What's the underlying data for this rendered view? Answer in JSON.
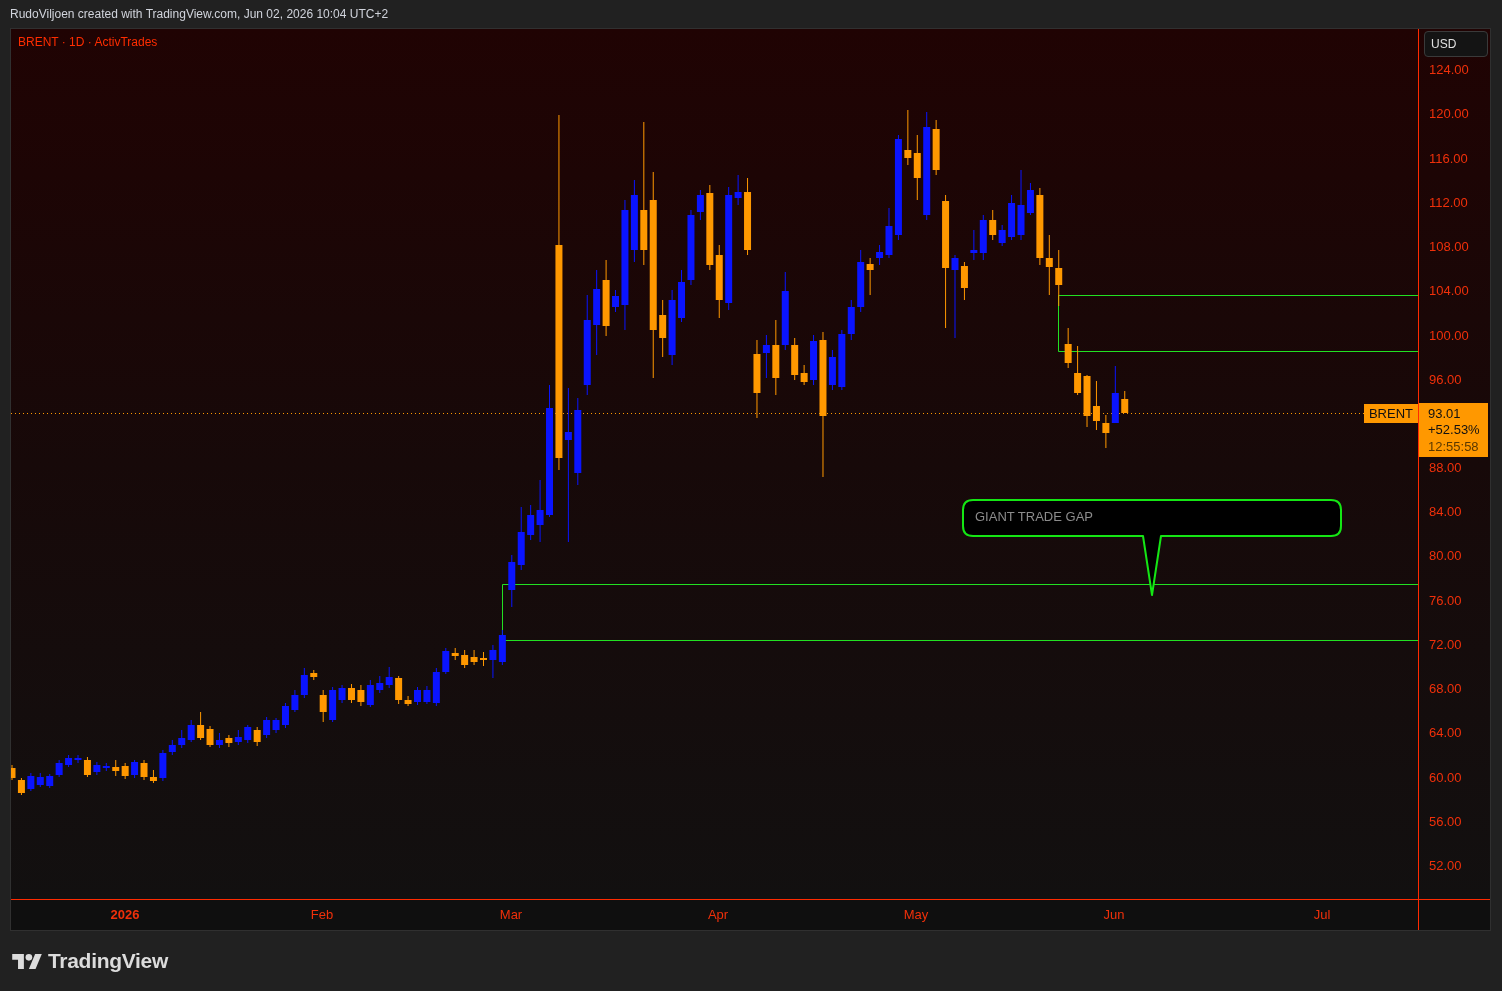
{
  "header": {
    "text": "RudoViljoen created with TradingView.com, Jun 02, 2026 10:04 UTC+2"
  },
  "chart": {
    "legend": "BRENT · 1D · ActivTrades",
    "symbol_tag": "BRENT",
    "annotation": "GIANT TRADE GAP",
    "currency_button": "USD",
    "price_axis": {
      "upper_ticks": [
        "124.00",
        "120.00",
        "116.00",
        "112.00",
        "108.00",
        "104.00",
        "100.00",
        "96.00"
      ],
      "lower_ticks": [
        "88.00",
        "84.00",
        "80.00",
        "76.00",
        "72.00",
        "68.00",
        "64.00",
        "60.00",
        "56.00",
        "52.00"
      ]
    },
    "last_price": {
      "price": "93.01",
      "change": "+52.53%",
      "countdown": "12:55:58"
    },
    "time_axis": [
      {
        "label": "2026",
        "kind": "year"
      },
      {
        "label": "Feb",
        "kind": "month"
      },
      {
        "label": "Mar",
        "kind": "month"
      },
      {
        "label": "Apr",
        "kind": "month"
      },
      {
        "label": "May",
        "kind": "month"
      },
      {
        "label": "Jun",
        "kind": "month"
      },
      {
        "label": "Jul",
        "kind": "month"
      }
    ]
  },
  "footer": {
    "brand": "TradingView"
  }
}
